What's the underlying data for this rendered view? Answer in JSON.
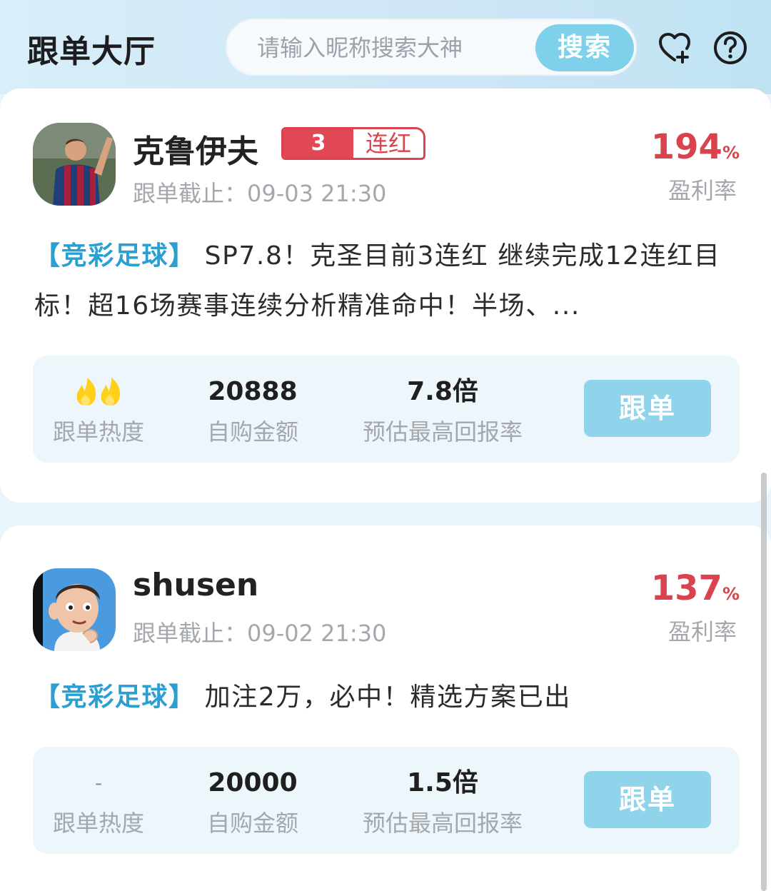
{
  "header": {
    "title": "跟单大厅",
    "search_placeholder": "请输入昵称搜索大神",
    "search_button": "搜索",
    "icons": [
      "heart-plus-icon",
      "help-icon"
    ]
  },
  "colors": {
    "accent": "#7fd0ea",
    "profit_red": "#d9434e",
    "tag_blue": "#2a9fd0"
  },
  "posts": [
    {
      "name": "克鲁伊夫",
      "streak_count": "3",
      "streak_label": "连红",
      "deadline": "跟单截止：09-03 21:30",
      "profit_value": "194",
      "profit_unit": "%",
      "profit_label": "盈利率",
      "tag": "【竞彩足球】",
      "text": "SP7.8！克圣目前3连红 继续完成12连红目标！超16场赛事连续分析精准命中！半场、...",
      "heat_icon": "fire-icon",
      "heat_level": 2,
      "heat_label": "跟单热度",
      "amount": "20888",
      "amount_label": "自购金额",
      "return": "7.8倍",
      "return_label": "预估最高回报率",
      "follow": "跟单"
    },
    {
      "name": "shusen",
      "deadline": "跟单截止：09-02 21:30",
      "profit_value": "137",
      "profit_unit": "%",
      "profit_label": "盈利率",
      "tag": "【竞彩足球】",
      "text": "加注2万，必中！精选方案已出",
      "heat_value": "-",
      "heat_label": "跟单热度",
      "amount": "20000",
      "amount_label": "自购金额",
      "return": "1.5倍",
      "return_label": "预估最高回报率",
      "follow": "跟单"
    }
  ]
}
